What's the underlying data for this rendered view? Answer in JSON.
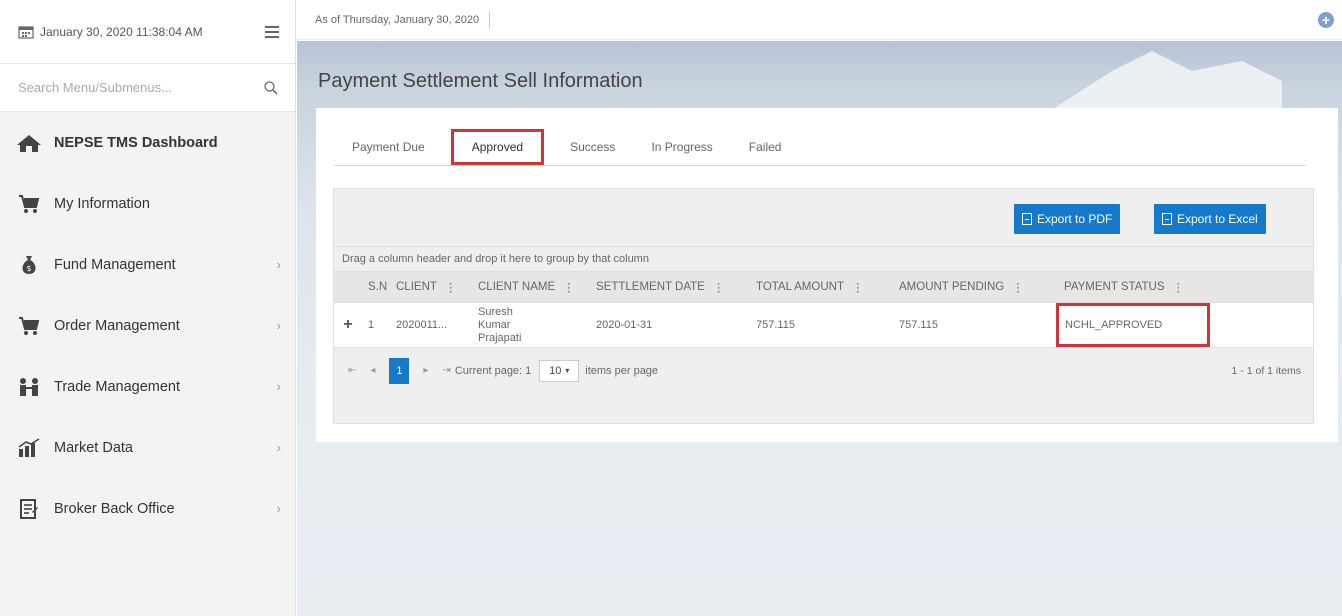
{
  "sidebar": {
    "datetime": "January 30, 2020 11:38:04 AM",
    "search_placeholder": "Search Menu/Submenus...",
    "items": [
      {
        "label": "NEPSE TMS Dashboard",
        "icon": "home-icon",
        "has_chevron": false
      },
      {
        "label": "My Information",
        "icon": "cart-icon",
        "has_chevron": false
      },
      {
        "label": "Fund Management",
        "icon": "money-bag-icon",
        "has_chevron": true
      },
      {
        "label": "Order Management",
        "icon": "cart-icon",
        "has_chevron": true
      },
      {
        "label": "Trade Management",
        "icon": "people-icon",
        "has_chevron": true
      },
      {
        "label": "Market Data",
        "icon": "chart-icon",
        "has_chevron": true
      },
      {
        "label": "Broker Back Office",
        "icon": "document-icon",
        "has_chevron": true
      }
    ],
    "chevron": "›"
  },
  "topbar": {
    "as_of": "As of Thursday, January 30, 2020",
    "plus": "+"
  },
  "page": {
    "title": "Payment Settlement Sell Information"
  },
  "tabs": [
    "Payment Due",
    "Approved",
    "Success",
    "In Progress",
    "Failed"
  ],
  "active_tab": "Approved",
  "grid": {
    "export_pdf": "Export to PDF",
    "export_excel": "Export to Excel",
    "group_hint": "Drag a column header and drop it here to group by that column",
    "columns": [
      "S.N",
      "CLIENT",
      "CLIENT NAME",
      "SETTLEMENT DATE",
      "TOTAL AMOUNT",
      "AMOUNT PENDING",
      "PAYMENT STATUS"
    ],
    "rows": [
      {
        "expand": "+",
        "sn": "1",
        "client": "2020011...",
        "client_name": "Suresh Kumar Prajapati",
        "settlement_date": "2020-01-31",
        "total_amount": "757.115",
        "amount_pending": "757.115",
        "payment_status": "NCHL_APPROVED"
      }
    ]
  },
  "pager": {
    "first": "⇤",
    "prev": "◂",
    "page": "1",
    "next": "▸",
    "last": "⇥",
    "current_page_label": "Current page: 1",
    "page_size": "10",
    "items_per_page": "items per page",
    "info": "1 - 1 of 1 items"
  },
  "colors": {
    "accent": "#1779c9",
    "highlight": "#d0343a"
  }
}
